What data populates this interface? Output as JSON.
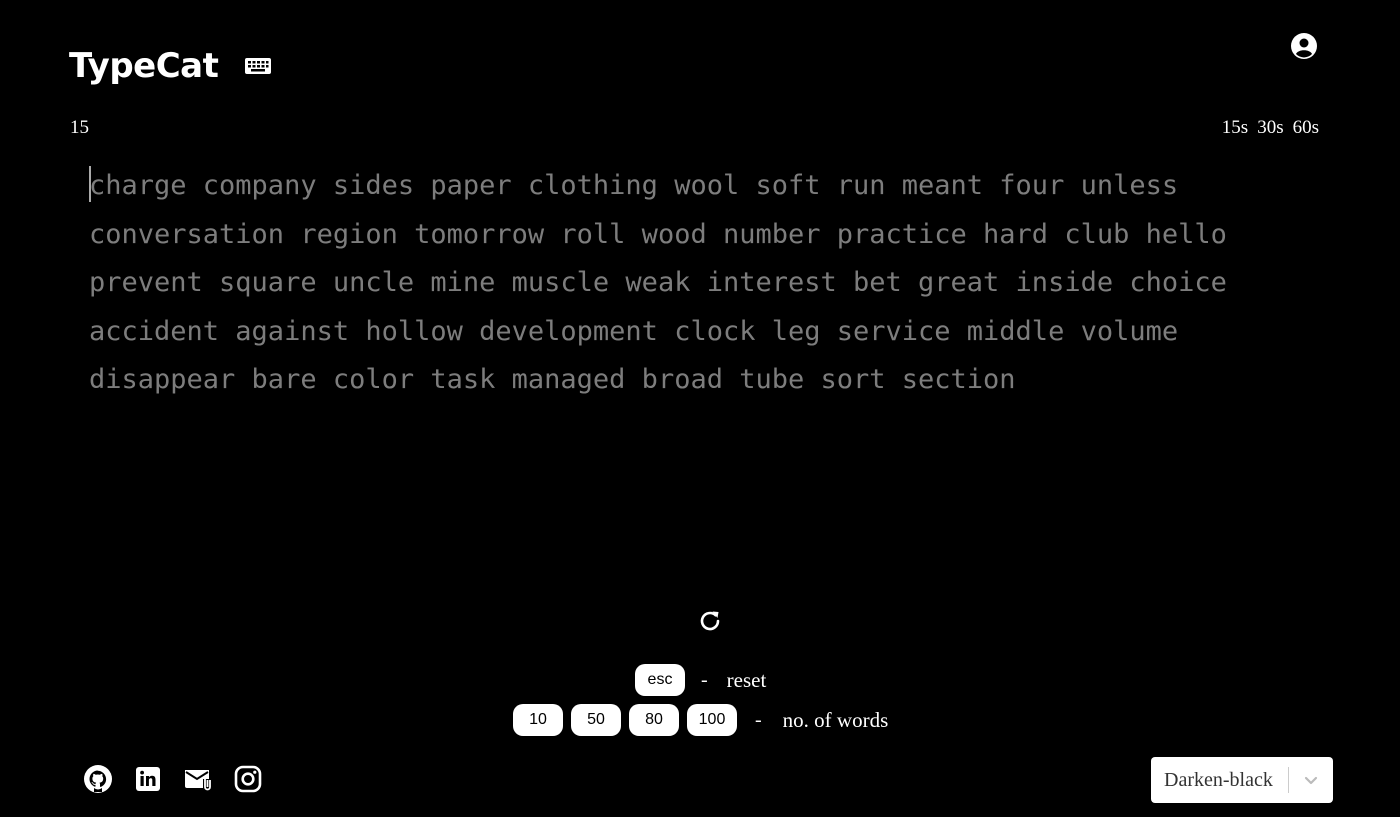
{
  "header": {
    "logo": "TypeCat",
    "keyboard_icon": "keyboard-icon",
    "account_icon": "account-circle-icon"
  },
  "test": {
    "timer": "15",
    "time_options": [
      "15s",
      "30s",
      "60s"
    ],
    "words": "charge company sides paper clothing wool soft run meant four unless conversation region tomorrow roll wood number practice hard club hello prevent square uncle mine muscle weak interest bet great inside choice accident against hollow development clock leg service middle volume disappear bare color task managed broad tube sort section"
  },
  "controls": {
    "reload_icon": "reload-icon",
    "esc_key": "esc",
    "reset_label": "reset",
    "dash": "-",
    "word_counts": [
      "10",
      "50",
      "80",
      "100"
    ],
    "words_label": "no. of words"
  },
  "footer": {
    "socials": [
      "github-icon",
      "linkedin-icon",
      "mail-icon",
      "instagram-icon"
    ],
    "theme_selected": "Darken-black"
  },
  "colors": {
    "background": "#000000",
    "text": "#ffffff",
    "untyped_words": "#7d7d7d"
  }
}
